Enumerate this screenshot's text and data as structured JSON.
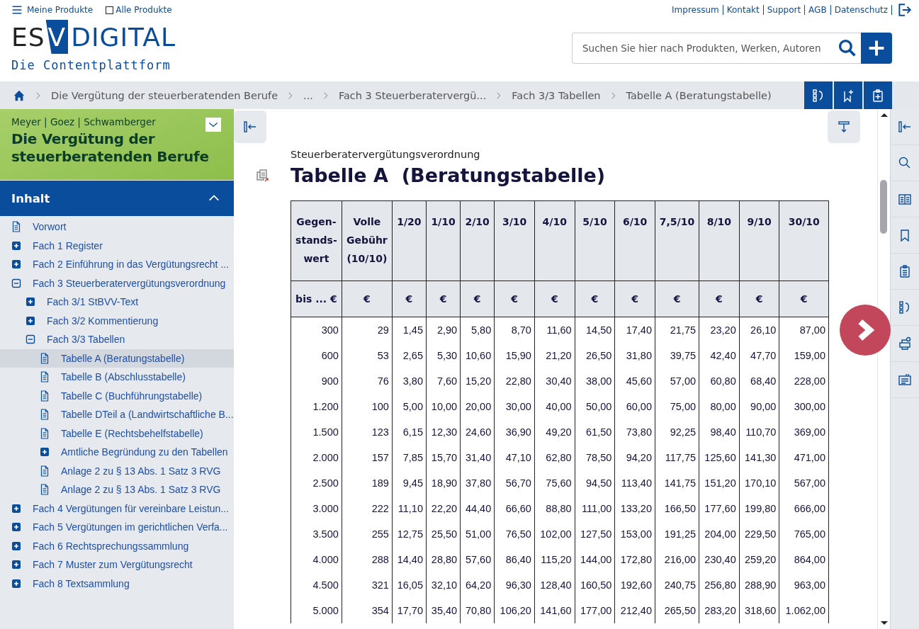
{
  "top_bar": {
    "menu_label": "Meine Produkte",
    "all_products": {
      "label": "Alle Produkte",
      "checked": false
    },
    "links": [
      "Impressum",
      "Kontakt",
      "Support",
      "AGB",
      "Datenschutz"
    ]
  },
  "logo": {
    "left": "ES",
    "mark": "V",
    "right": "DIGITAL",
    "tagline": "Die Contentplattform"
  },
  "search": {
    "placeholder": "Suchen Sie hier nach Produkten, Werken, Autoren"
  },
  "breadcrumb": [
    "Die Vergütung der steuerberatenden Berufe",
    "...",
    "Fach 3 Steuerberatervergü...",
    "Fach 3/3 Tabellen",
    "Tabelle A (Beratungstabelle)"
  ],
  "book": {
    "authors": "Meyer | Goez | Schwamberger",
    "title": "Die Vergütung der steuerberatenden Berufe"
  },
  "toc": {
    "title": "Inhalt",
    "expanded": true,
    "items": [
      {
        "kind": "doc",
        "label": "Vorwort",
        "selected": false
      },
      {
        "kind": "folder",
        "label": "Fach 1 Register",
        "expanded": false,
        "selected": false
      },
      {
        "kind": "folder",
        "label": "Fach 2 Einführung in das Vergütungsrecht ...",
        "expanded": false,
        "selected": false
      },
      {
        "kind": "folder",
        "label": "Fach 3 Steuerberatervergütungsverordnung",
        "expanded": true,
        "selected": false,
        "children": [
          {
            "kind": "folder",
            "label": "Fach 3/1 StBVV-Text",
            "expanded": false,
            "selected": false
          },
          {
            "kind": "folder",
            "label": "Fach 3/2 Kommentierung",
            "expanded": false,
            "selected": false
          },
          {
            "kind": "folder",
            "label": "Fach 3/3 Tabellen",
            "expanded": true,
            "selected": false,
            "children": [
              {
                "kind": "doc",
                "label": "Tabelle A (Beratungstabelle)",
                "selected": true
              },
              {
                "kind": "doc",
                "label": "Tabelle B (Abschlusstabelle)",
                "selected": false
              },
              {
                "kind": "doc",
                "label": "Tabelle C (Buchführungstabelle)",
                "selected": false
              },
              {
                "kind": "doc",
                "label": "Tabelle DTeil a (Landwirtschaftliche B...",
                "selected": false
              },
              {
                "kind": "doc",
                "label": "Tabelle E (Rechtsbehelfstabelle)",
                "selected": false
              },
              {
                "kind": "folder",
                "label": "Amtliche Begründung zu den Tabellen",
                "expanded": false,
                "selected": false
              },
              {
                "kind": "doc",
                "label": "Anlage 2 zu § 13 Abs. 1 Satz 3 RVG",
                "selected": false
              },
              {
                "kind": "doc",
                "label": "Anlage 2 zu § 13 Abs. 1 Satz 3 RVG",
                "selected": false
              }
            ]
          }
        ]
      },
      {
        "kind": "folder",
        "label": "Fach 4 Vergütungen für vereinbare Leistun...",
        "expanded": false,
        "selected": false
      },
      {
        "kind": "folder",
        "label": "Fach 5 Vergütungen im gerichtlichen Verfa...",
        "expanded": false,
        "selected": false
      },
      {
        "kind": "folder",
        "label": "Fach 6 Rechtsprechungssammlung",
        "expanded": false,
        "selected": false
      },
      {
        "kind": "folder",
        "label": "Fach 7 Muster zum Vergütungsrecht",
        "expanded": false,
        "selected": false
      },
      {
        "kind": "folder",
        "label": "Fach 8 Textsammlung",
        "expanded": false,
        "selected": false
      }
    ]
  },
  "document": {
    "overline": "Steuerberatervergütungsverordnung",
    "title": "Tabelle A  (Beratungstabelle)",
    "table": {
      "columns": [
        "Gegen-\nstands-\nwert",
        "Volle\nGebühr\n(10/10)",
        "1/20",
        "1/10",
        "2/10",
        "3/10",
        "4/10",
        "5/10",
        "6/10",
        "7,5/10",
        "8/10",
        "9/10",
        "30/10"
      ],
      "units": [
        "bis ... €",
        "€",
        "€",
        "€",
        "€",
        "€",
        "€",
        "€",
        "€",
        "€",
        "€",
        "€",
        "€"
      ],
      "rows": [
        [
          "300",
          "29",
          "1,45",
          "2,90",
          "5,80",
          "8,70",
          "11,60",
          "14,50",
          "17,40",
          "21,75",
          "23,20",
          "26,10",
          "87,00"
        ],
        [
          "600",
          "53",
          "2,65",
          "5,30",
          "10,60",
          "15,90",
          "21,20",
          "26,50",
          "31,80",
          "39,75",
          "42,40",
          "47,70",
          "159,00"
        ],
        [
          "900",
          "76",
          "3,80",
          "7,60",
          "15,20",
          "22,80",
          "30,40",
          "38,00",
          "45,60",
          "57,00",
          "60,80",
          "68,40",
          "228,00"
        ],
        [
          "1.200",
          "100",
          "5,00",
          "10,00",
          "20,00",
          "30,00",
          "40,00",
          "50,00",
          "60,00",
          "75,00",
          "80,00",
          "90,00",
          "300,00"
        ],
        [
          "1.500",
          "123",
          "6,15",
          "12,30",
          "24,60",
          "36,90",
          "49,20",
          "61,50",
          "73,80",
          "92,25",
          "98,40",
          "110,70",
          "369,00"
        ],
        [
          "2.000",
          "157",
          "7,85",
          "15,70",
          "31,40",
          "47,10",
          "62,80",
          "78,50",
          "94,20",
          "117,75",
          "125,60",
          "141,30",
          "471,00"
        ],
        [
          "2.500",
          "189",
          "9,45",
          "18,90",
          "37,80",
          "56,70",
          "75,60",
          "94,50",
          "113,40",
          "141,75",
          "151,20",
          "170,10",
          "567,00"
        ],
        [
          "3.000",
          "222",
          "11,10",
          "22,20",
          "44,40",
          "66,60",
          "88,80",
          "111,00",
          "133,20",
          "166,50",
          "177,60",
          "199,80",
          "666,00"
        ],
        [
          "3.500",
          "255",
          "12,75",
          "25,50",
          "51,00",
          "76,50",
          "102,00",
          "127,50",
          "153,00",
          "191,25",
          "204,00",
          "229,50",
          "765,00"
        ],
        [
          "4.000",
          "288",
          "14,40",
          "28,80",
          "57,60",
          "86,40",
          "115,20",
          "144,00",
          "172,80",
          "216,00",
          "230,40",
          "259,20",
          "864,00"
        ],
        [
          "4.500",
          "321",
          "16,05",
          "32,10",
          "64,20",
          "96,30",
          "128,40",
          "160,50",
          "192,60",
          "240,75",
          "256,80",
          "288,90",
          "963,00"
        ],
        [
          "5.000",
          "354",
          "17,70",
          "35,40",
          "70,80",
          "106,20",
          "141,60",
          "177,00",
          "212,40",
          "265,50",
          "283,20",
          "318,60",
          "1.062,00"
        ]
      ]
    }
  }
}
